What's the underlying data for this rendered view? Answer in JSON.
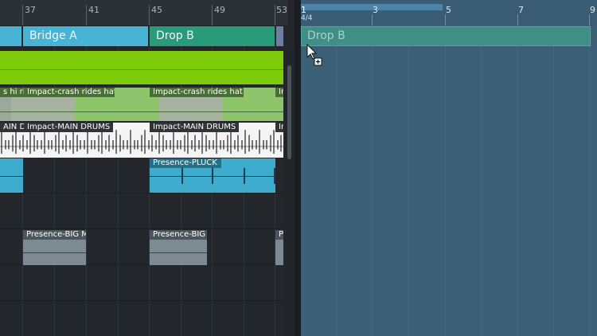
{
  "ruler": {
    "bars": [
      "37",
      "41",
      "45",
      "49",
      "53"
    ]
  },
  "arrangement": {
    "sections": [
      {
        "name": "",
        "color": "#49b3d6"
      },
      {
        "name": "Bridge A",
        "color": "#49b3d6"
      },
      {
        "name": "Drop B",
        "color": "#2a9b78"
      },
      {
        "name": "",
        "color": "#6d7fa6"
      }
    ]
  },
  "tracks": {
    "crash": {
      "left_label": "s hi ric",
      "label_1": "Impact-crash rides hat",
      "label_2": "Impact-crash rides hat",
      "label_3": "Im"
    },
    "drums": {
      "left_label": "AIN DI",
      "label_1": "Impact-MAIN DRUMS",
      "label_2": "Impact-MAIN DRUMS",
      "label_3": "In"
    },
    "pluck": {
      "label_1": "Presence-PLUCK"
    },
    "big": {
      "label_1": "Presence-BIG M",
      "label_2": "Presence-BIG",
      "label_3": "P"
    }
  },
  "scratch_pad": {
    "time_signature": "4/4",
    "bars": [
      "1",
      "3",
      "5",
      "7",
      "9"
    ],
    "drop_label": "Drop B",
    "colors": {
      "background": "#3c5f78",
      "ruler": "#3a5d75"
    }
  },
  "cursor": {
    "icon": "copy-drag-cursor-icon"
  }
}
